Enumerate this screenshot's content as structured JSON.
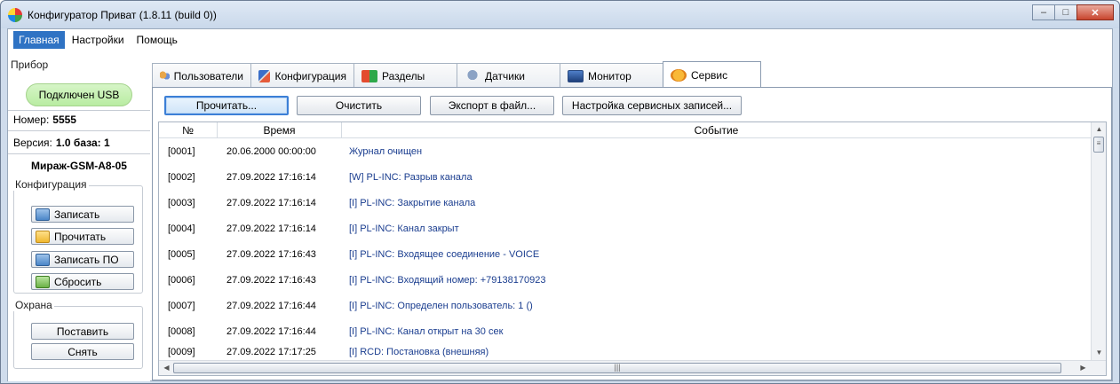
{
  "window": {
    "title": "Конфигуратор Приват (1.8.11 (build 0))",
    "controls": [
      "minimize",
      "maximize",
      "close"
    ]
  },
  "menu": {
    "items": [
      "Главная",
      "Настройки",
      "Помощь"
    ],
    "active_index": 0
  },
  "device": {
    "group_label": "Прибор",
    "status": "Подключен USB",
    "number_label": "Номер:",
    "number_value": "5555",
    "version_label": "Версия:",
    "version_value": "1.0 база: 1",
    "model": "Мираж-GSM-A8-05"
  },
  "config": {
    "group_label": "Конфигурация",
    "buttons": [
      {
        "label": "Записать",
        "icon": "disk-icon"
      },
      {
        "label": "Прочитать",
        "icon": "folder-icon"
      },
      {
        "label": "Записать ПО",
        "icon": "disk-icon"
      },
      {
        "label": "Сбросить",
        "icon": "reset-icon"
      }
    ]
  },
  "guard": {
    "group_label": "Охрана",
    "buttons": [
      "Поставить",
      "Снять"
    ]
  },
  "tabs": [
    {
      "label": "Пользователи",
      "icon": "users-icon"
    },
    {
      "label": "Конфигурация",
      "icon": "configuration-icon"
    },
    {
      "label": "Разделы",
      "icon": "sections-icon"
    },
    {
      "label": "Датчики",
      "icon": "sensors-icon"
    },
    {
      "label": "Монитор",
      "icon": "monitor-icon"
    },
    {
      "label": "Сервис",
      "icon": "service-icon"
    }
  ],
  "active_tab": 5,
  "toolbar": {
    "read": "Прочитать...",
    "clear": "Очистить",
    "export": "Экспорт в файл...",
    "settings": "Настройка сервисных записей..."
  },
  "log": {
    "columns": [
      "№",
      "Время",
      "Событие"
    ],
    "rows": [
      {
        "num": "[0001]",
        "time": "20.06.2000 00:00:00",
        "event": "Журнал очищен"
      },
      {
        "num": "[0002]",
        "time": "27.09.2022 17:16:14",
        "event": "[W] PL-INC: Разрыв канала"
      },
      {
        "num": "[0003]",
        "time": "27.09.2022 17:16:14",
        "event": "[I] PL-INC: Закрытие канала"
      },
      {
        "num": "[0004]",
        "time": "27.09.2022 17:16:14",
        "event": "[I] PL-INC: Канал закрыт"
      },
      {
        "num": "[0005]",
        "time": "27.09.2022 17:16:43",
        "event": "[I] PL-INC: Входящее соединение - VOICE"
      },
      {
        "num": "[0006]",
        "time": "27.09.2022 17:16:43",
        "event": "[I] PL-INC: Входящий номер: +79138170923"
      },
      {
        "num": "[0007]",
        "time": "27.09.2022 17:16:44",
        "event": "[I] PL-INC: Определен пользователь: 1 ()"
      },
      {
        "num": "[0008]",
        "time": "27.09.2022 17:16:44",
        "event": "[I] PL-INC: Канал открыт на 30 сек"
      },
      {
        "num": "[0009]",
        "time": "27.09.2022 17:17:25",
        "event": "[I] RCD: Постановка (внешняя)"
      }
    ]
  }
}
